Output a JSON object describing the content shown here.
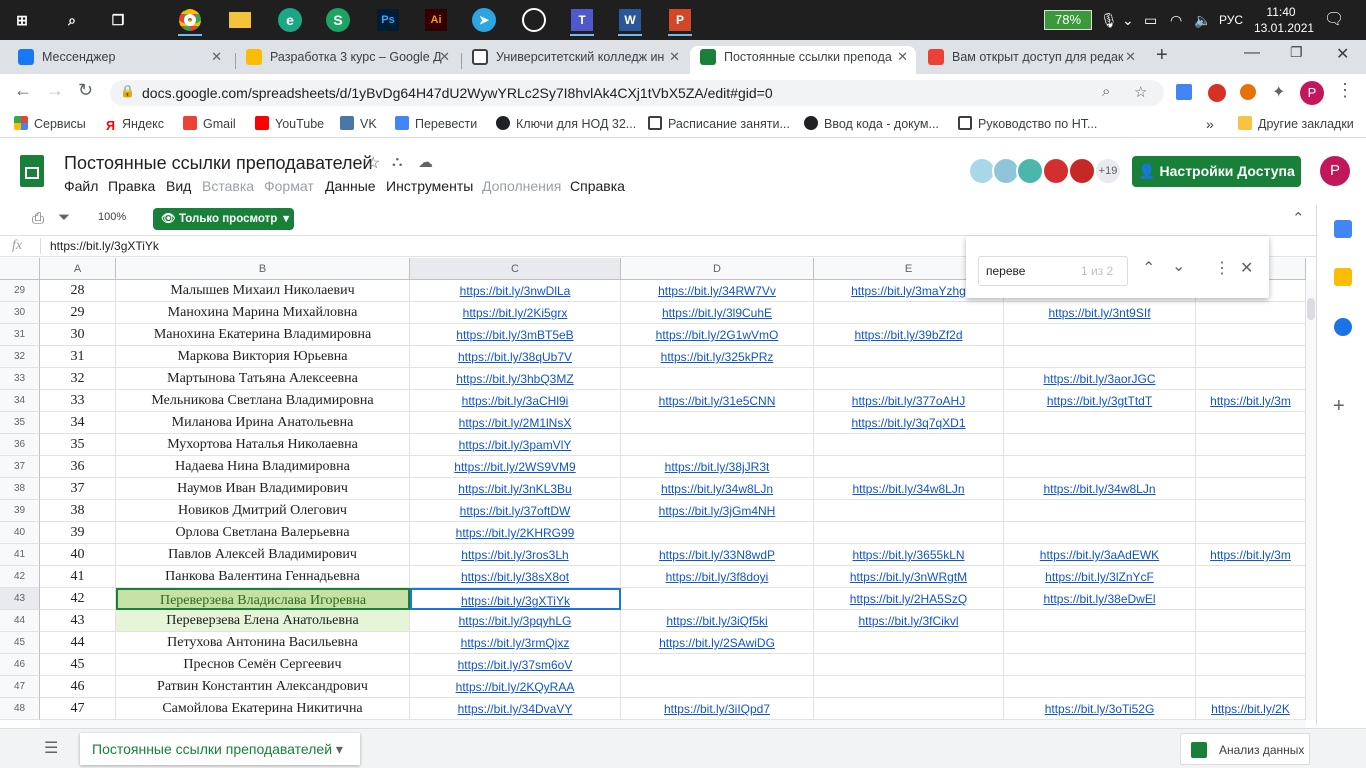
{
  "taskbar": {
    "battery": "78%",
    "lang": "РУС",
    "time": "11:40",
    "date": "13.01.2021"
  },
  "tabs": [
    {
      "title": "Мессенджер",
      "color": "#1877f2"
    },
    {
      "title": "Разработка 3 курс – Google Д",
      "color": "#fbbc04"
    },
    {
      "title": "Университетский колледж ин",
      "color": "#3c4043"
    },
    {
      "title": "Постоянные ссылки препода",
      "color": "#188038"
    },
    {
      "title": "Вам открыт доступ для редак",
      "color": "#ea4335"
    }
  ],
  "address": {
    "url": "docs.google.com/spreadsheets/d/1yBvDg64H47dU2WywYRLc2Sy7I8hvlAk4CXj1tVbX5ZA/edit#gid=0",
    "profile": "P"
  },
  "bookmarks": [
    {
      "label": "Сервисы",
      "color": "#ea4335"
    },
    {
      "label": "Яндекс",
      "color": "#ff0000"
    },
    {
      "label": "Gmail",
      "color": "#ea4335"
    },
    {
      "label": "YouTube",
      "color": "#ff0000"
    },
    {
      "label": "VK",
      "color": "#4a76a8"
    },
    {
      "label": "Перевести",
      "color": "#4285f4"
    },
    {
      "label": "Ключи для НОД 32...",
      "color": "#202124"
    },
    {
      "label": "Расписание заняти...",
      "color": "#3c4043"
    },
    {
      "label": "Ввод кода - докум...",
      "color": "#202124"
    },
    {
      "label": "Руководство по НТ...",
      "color": "#3c4043"
    }
  ],
  "other_bookmarks": "Другие закладки",
  "doc": {
    "title": "Постоянные ссылки преподавателей",
    "share_label": "Настройки Доступа",
    "collab_count": "+19",
    "user": "P"
  },
  "menus": [
    {
      "label": "Файл",
      "enabled": true
    },
    {
      "label": "Правка",
      "enabled": true
    },
    {
      "label": "Вид",
      "enabled": true
    },
    {
      "label": "Вставка",
      "enabled": false
    },
    {
      "label": "Формат",
      "enabled": false
    },
    {
      "label": "Данные",
      "enabled": true
    },
    {
      "label": "Инструменты",
      "enabled": true
    },
    {
      "label": "Дополнения",
      "enabled": false
    },
    {
      "label": "Справка",
      "enabled": true
    }
  ],
  "toolbar": {
    "zoom": "100%",
    "view_only": "Только просмотр"
  },
  "formula": {
    "fx": "fx",
    "value": "https://bit.ly/3gXTiYk"
  },
  "find": {
    "query": "переве",
    "count": "1 из 2"
  },
  "columns": [
    "A",
    "B",
    "C",
    "D",
    "E",
    "F",
    "G"
  ],
  "rows": [
    {
      "rn": "29",
      "a": "28",
      "b": "Малышев Михаил Николаевич",
      "c": "https://bit.ly/3nwDlLa",
      "d": "https://bit.ly/34RW7Vv",
      "e": "https://bit.ly/3maYzhg",
      "f": "",
      "g": ""
    },
    {
      "rn": "30",
      "a": "29",
      "b": "Манохина Марина Михайловна",
      "c": "https://bit.ly/2Ki5grx",
      "d": "https://bit.ly/3l9CuhE",
      "e": "",
      "f": "https://bit.ly/3nt9SIf",
      "g": ""
    },
    {
      "rn": "31",
      "a": "30",
      "b": "Манохина Екатерина Владимировна",
      "c": "https://bit.ly/3mBT5eB",
      "d": "https://bit.ly/2G1wVmO",
      "e": "https://bit.ly/39bZf2d",
      "f": "",
      "g": ""
    },
    {
      "rn": "32",
      "a": "31",
      "b": "Маркова Виктория Юрьевна",
      "c": "https://bit.ly/38qUb7V",
      "d": "https://bit.ly/325kPRz",
      "e": "",
      "f": "",
      "g": ""
    },
    {
      "rn": "33",
      "a": "32",
      "b": "Мартынова Татьяна Алексеевна",
      "c": "https://bit.ly/3hbQ3MZ",
      "d": "",
      "e": "",
      "f": "https://bit.ly/3aorJGC",
      "g": ""
    },
    {
      "rn": "34",
      "a": "33",
      "b": "Мельникова Светлана Владимировна",
      "c": "https://bit.ly/3aCHl9i",
      "d": "https://bit.ly/31e5CNN",
      "e": "https://bit.ly/377oAHJ",
      "f": "https://bit.ly/3gtTtdT",
      "g": "https://bit.ly/3m"
    },
    {
      "rn": "35",
      "a": "34",
      "b": "Миланова Ирина Анатольевна",
      "c": "https://bit.ly/2M1lNsX",
      "d": "",
      "e": "https://bit.ly/3q7qXD1",
      "f": "",
      "g": ""
    },
    {
      "rn": "36",
      "a": "35",
      "b": "Мухортова Наталья Николаевна",
      "c": "https://bit.ly/3pamVlY",
      "d": "",
      "e": "",
      "f": "",
      "g": ""
    },
    {
      "rn": "37",
      "a": "36",
      "b": "Надаева Нина Владимировна",
      "c": "https://bit.ly/2WS9VM9",
      "d": "https://bit.ly/38jJR3t",
      "e": "",
      "f": "",
      "g": ""
    },
    {
      "rn": "38",
      "a": "37",
      "b": "Наумов Иван Владимирович",
      "c": "https://bit.ly/3nKL3Bu",
      "d": "https://bit.ly/34w8LJn",
      "e": "https://bit.ly/34w8LJn",
      "f": "https://bit.ly/34w8LJn",
      "g": ""
    },
    {
      "rn": "39",
      "a": "38",
      "b": "Новиков Дмитрий Олегович",
      "c": "https://bit.ly/37oftDW",
      "d": "https://bit.ly/3jGm4NH",
      "e": "",
      "f": "",
      "g": ""
    },
    {
      "rn": "40",
      "a": "39",
      "b": "Орлова Светлана Валерьевна",
      "c": "https://bit.ly/2KHRG99",
      "d": "",
      "e": "",
      "f": "",
      "g": ""
    },
    {
      "rn": "41",
      "a": "40",
      "b": "Павлов Алексей Владимирович",
      "c": "https://bit.ly/3ros3Lh",
      "d": "https://bit.ly/33N8wdP",
      "e": "https://bit.ly/3655kLN",
      "f": "https://bit.ly/3aAdEWK",
      "g": "https://bit.ly/3m"
    },
    {
      "rn": "42",
      "a": "41",
      "b": "Панкова Валентина Геннадьевна",
      "c": "https://bit.ly/38sX8ot",
      "d": "https://bit.ly/3f8doyi",
      "e": "https://bit.ly/3nWRgtM",
      "f": "https://bit.ly/3lZnYcF",
      "g": ""
    },
    {
      "rn": "43",
      "a": "42",
      "b": "Переверзева Владислава Игоревна",
      "c": "https://bit.ly/3gXTiYk",
      "d": "",
      "e": "https://bit.ly/2HA5SzQ",
      "f": "https://bit.ly/38eDwEl",
      "g": ""
    },
    {
      "rn": "44",
      "a": "43",
      "b": "Переверзева Елена Анатольевна",
      "c": "https://bit.ly/3pqyhLG",
      "d": "https://bit.ly/3iQf5ki",
      "e": "https://bit.ly/3fCikvl",
      "f": "",
      "g": ""
    },
    {
      "rn": "45",
      "a": "44",
      "b": "Петухова Антонина Васильевна",
      "c": "https://bit.ly/3rmQjxz",
      "d": "https://bit.ly/2SAwiDG",
      "e": "",
      "f": "",
      "g": ""
    },
    {
      "rn": "46",
      "a": "45",
      "b": "Преснов Семён Сергеевич",
      "c": "https://bit.ly/37sm6oV",
      "d": "",
      "e": "",
      "f": "",
      "g": ""
    },
    {
      "rn": "47",
      "a": "46",
      "b": "Ратвин Константин Александрович",
      "c": "https://bit.ly/2KQyRAA",
      "d": "",
      "e": "",
      "f": "",
      "g": ""
    },
    {
      "rn": "48",
      "a": "47",
      "b": "Самойлова Екатерина Никитична",
      "c": "https://bit.ly/34DvaVY",
      "d": "https://bit.ly/3iIQpd7",
      "e": "",
      "f": "https://bit.ly/3oTi52G",
      "g": "https://bit.ly/2K"
    }
  ],
  "sheet_tab": "Постоянные ссылки преподавателей",
  "explore": "Анализ данных"
}
